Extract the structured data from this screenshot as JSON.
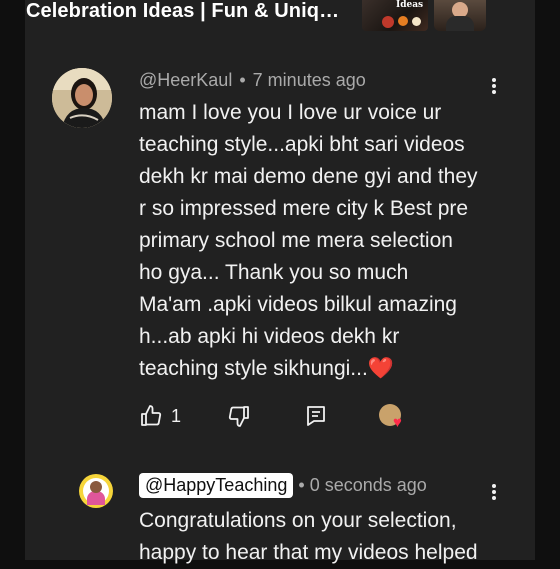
{
  "video": {
    "title": "Celebration Ideas | Fun & Uniq…",
    "thumbnail_sticker_text": "Ideas"
  },
  "comment": {
    "author": "@HeerKaul",
    "separator": "•",
    "time": "7 minutes ago",
    "lines": [
      "mam I love you I love ur voice ur",
      "teaching style...apki bht sari videos",
      "dekh kr mai demo dene gyi and they",
      "r so impressed mere city k Best pre",
      "primary school me mera selection",
      "ho gya... Thank you so much",
      "Ma'am .apki videos bilkul amazing",
      "h...ab apki hi videos dekh kr",
      "teaching style sikhungi...❤️"
    ],
    "like_count": "1",
    "icons": {
      "like": "thumbs-up-icon",
      "dislike": "thumbs-down-icon",
      "reply": "reply-comment-icon",
      "creator_heart": "creator-heart-icon",
      "more": "more-vert-icon"
    },
    "heart_color": "#ff2b4a"
  },
  "reply": {
    "author": "@HappyTeaching",
    "separator": "•",
    "time": "0 seconds ago",
    "lines": [
      "Congratulations on your selection,",
      "happy to hear that my videos helped"
    ]
  },
  "colors": {
    "background": "#0f0f0f",
    "panel": "#212121",
    "text_primary": "#f1f1f1",
    "text_secondary": "#aaaaaa",
    "chip_bg": "#ffffff"
  }
}
